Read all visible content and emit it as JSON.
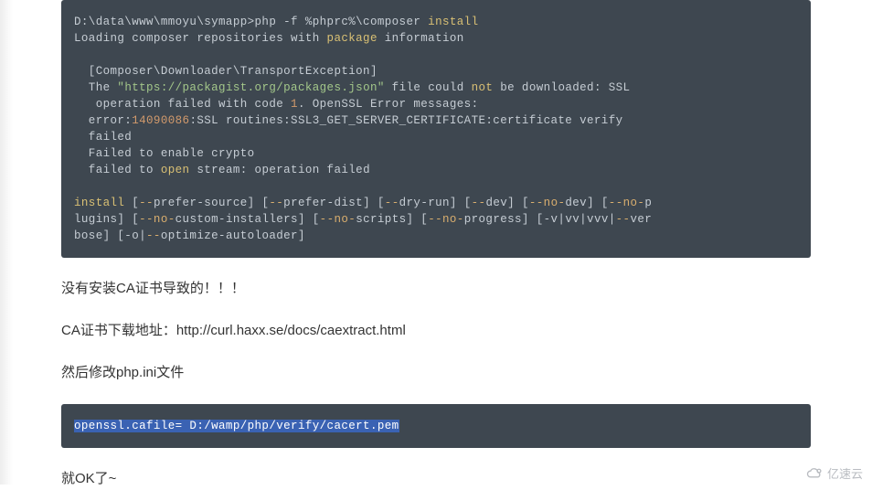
{
  "codeblock1": {
    "line1_a": "D:\\data\\www\\mmoyu\\symapp>php -f %phprc%\\composer ",
    "line1_b": "install",
    "line2_a": "Loading composer repositories with ",
    "line2_b": "package",
    "line2_c": " information",
    "line4": "  [Composer\\Downloader\\TransportException]",
    "line5_a": "  The ",
    "line5_b": "\"https://packagist.org/packages.json\"",
    "line5_c": " file could ",
    "line5_d": "not",
    "line5_e": " be downloaded: SSL",
    "line6_a": "   operation failed with code ",
    "line6_b": "1",
    "line6_c": ". OpenSSL Error messages:",
    "line7_a": "  error:",
    "line7_b": "14090086",
    "line7_c": ":SSL routines:SSL3_GET_SERVER_CERTIFICATE:certificate verify",
    "line8": "  failed",
    "line9": "  Failed to enable crypto",
    "line10_a": "  failed to ",
    "line10_b": "open",
    "line10_c": " stream: operation failed",
    "line12_a": "install",
    "line12_b": " [",
    "line12_c": "--",
    "line12_d": "prefer-source] [",
    "line12_e": "--",
    "line12_f": "prefer-dist] [",
    "line12_g": "--",
    "line12_h": "dry-run] [",
    "line12_i": "--",
    "line12_j": "dev] [",
    "line12_k": "--no-",
    "line12_l": "dev] [",
    "line12_m": "--no-",
    "line12_n": "p",
    "line13_a": "lugins] [",
    "line13_b": "--no-",
    "line13_c": "custom-installers] [",
    "line13_d": "--no-",
    "line13_e": "scripts] [",
    "line13_f": "--no-",
    "line13_g": "progress] [-v|vv|vvv|",
    "line13_h": "--",
    "line13_i": "ver",
    "line14_a": "bose] [-o|",
    "line14_b": "--",
    "line14_c": "optimize-autoloader]"
  },
  "paragraphs": {
    "p1": "没有安装CA证书导致的！！！",
    "p2": "CA证书下载地址：http://curl.haxx.se/docs/caextract.html",
    "p3": "然后修改php.ini文件",
    "p4": "就OK了~"
  },
  "codeblock2": {
    "content": "openssl.cafile= D:/wamp/php/verify/cacert.pem"
  },
  "watermark": {
    "text": "亿速云"
  }
}
